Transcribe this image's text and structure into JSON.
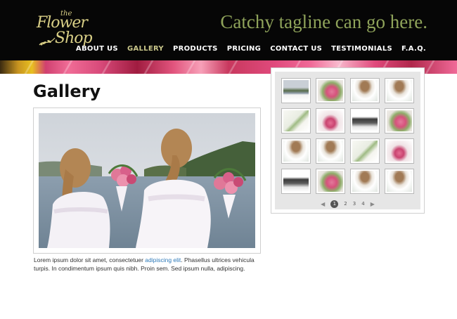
{
  "brand": {
    "logo_the": "the",
    "logo_flower": "Flower",
    "logo_shop": "Shop",
    "tagline": "Catchy tagline can go here."
  },
  "nav": {
    "items": [
      {
        "label": "ABOUT US",
        "active": false
      },
      {
        "label": "GALLERY",
        "active": true
      },
      {
        "label": "PRODUCTS",
        "active": false
      },
      {
        "label": "PRICING",
        "active": false
      },
      {
        "label": "CONTACT US",
        "active": false
      },
      {
        "label": "TESTIMONIALS",
        "active": false
      },
      {
        "label": "F.A.Q.",
        "active": false
      }
    ]
  },
  "main": {
    "title": "Gallery",
    "caption_before": "Lorem ipsum dolor sit amet, consectetuer ",
    "caption_link": "adipiscing elit",
    "caption_after": ". Phasellus ultrices vehicula turpis. In condimentum ipsum quis nibh. Proin sem. Sed ipsum nulla, adipiscing."
  },
  "gallery": {
    "thumbnails": [
      "beach",
      "roses",
      "girl",
      "girl",
      "white",
      "bouquet",
      "dark",
      "roses",
      "girl",
      "girl",
      "white",
      "bouquet",
      "dark",
      "roses",
      "girl",
      "girl"
    ],
    "pager": {
      "prev_icon": "◀",
      "next_icon": "▶",
      "pages": [
        "1",
        "2",
        "3",
        "4"
      ],
      "current": "1"
    }
  },
  "colors": {
    "header_bg": "#060606",
    "tagline": "#8fa35a",
    "logo": "#d9cf86",
    "nav_active": "#c9c68a",
    "link": "#2d79b8"
  }
}
